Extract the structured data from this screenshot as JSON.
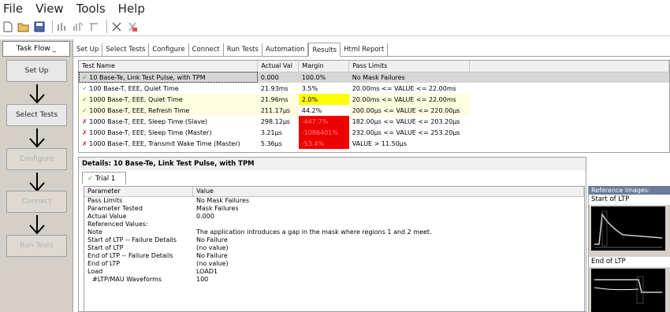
{
  "menu": {
    "items": [
      "File",
      "View",
      "Tools",
      "Help"
    ]
  },
  "toolbar": {
    "buttons": [
      "new-icon",
      "open-icon",
      "save-icon",
      "run-icon",
      "pause-icon",
      "step-icon",
      "stop-icon",
      "clear-icon"
    ]
  },
  "sidebar": {
    "header": "Task Flow",
    "steps": [
      {
        "label": "Set Up",
        "enabled": true
      },
      {
        "label": "Select Tests",
        "enabled": true
      },
      {
        "label": "Configure",
        "enabled": false
      },
      {
        "label": "Connect",
        "enabled": false
      },
      {
        "label": "Run Tests",
        "enabled": false
      }
    ]
  },
  "tabs": [
    "Set Up",
    "Select Tests",
    "Configure",
    "Connect",
    "Run Tests",
    "Automation",
    "Results",
    "Html Report"
  ],
  "active_tab": "Results",
  "results": {
    "columns": [
      "Test Name",
      "Actual Val",
      "Margin",
      "Pass Limits"
    ],
    "rows": [
      {
        "status": "pass",
        "name": "10 Base-Te, Link Test Pulse, with TPM",
        "actual": "0.000",
        "margin": "100.0%",
        "limits": "No Mask Failures",
        "highlight": ""
      },
      {
        "status": "pass",
        "name": "100 Base-T, EEE, Quiet Time",
        "actual": "21.93ms",
        "margin": "3.5%",
        "limits": "20.00ms <= VALUE <= 22.00ms",
        "highlight": ""
      },
      {
        "status": "pass",
        "name": "1000 Base-T, EEE, Quiet Time",
        "actual": "21.96ms",
        "margin": "2.0%",
        "limits": "20.00ms <= VALUE <= 22.00ms",
        "highlight": "yellow"
      },
      {
        "status": "pass",
        "name": "1000 Base-T, EEE, Refresh Time",
        "actual": "211.17µs",
        "margin": "44.2%",
        "limits": "200.00µs <= VALUE <= 220.00µs",
        "highlight": ""
      },
      {
        "status": "fail",
        "name": "1000 Base-T, EEE, Sleep Time (Slave)",
        "actual": "298.12µs",
        "margin": "-447.7%",
        "limits": "182.00µs <= VALUE <= 203.20µs",
        "highlight": "red"
      },
      {
        "status": "fail",
        "name": "1000 Base-T, EEE, Sleep Time (Master)",
        "actual": "3.21µs",
        "margin": "-1086401%",
        "limits": "232.00µs <= VALUE <= 253.20µs",
        "highlight": "red"
      },
      {
        "status": "fail",
        "name": "1000 Base-T, EEE, Transmit Wake Time (Master)",
        "actual": "5.36µs",
        "margin": "-53.4%",
        "limits": "VALUE > 11.50µs",
        "highlight": "red"
      }
    ]
  },
  "details": {
    "title": "Details: 10 Base-Te, Link Test Pulse, with TPM",
    "trial_tab": "Trial 1",
    "columns": [
      "Parameter",
      "Value"
    ],
    "rows": [
      {
        "param": "Pass Limits",
        "value": "No Mask Failures"
      },
      {
        "param": "Parameter Tested",
        "value": "Mask Failures"
      },
      {
        "param": "Actual Value",
        "value": "0.000"
      },
      {
        "param": "Referenced Values:",
        "value": ""
      },
      {
        "param": "Note",
        "value": "The application introduces a gap in the mask where regions 1 and 2 meet."
      },
      {
        "param": "Start of LTP -- Failure Details",
        "value": "No Failure"
      },
      {
        "param": "Start of LTP",
        "value": "(no value)"
      },
      {
        "param": "End of LTP -- Failure Details",
        "value": "No Failure"
      },
      {
        "param": "End of LTP",
        "value": "(no value)"
      },
      {
        "param": "Load",
        "value": "LOAD1"
      },
      {
        "param": "#LTP/MAU Waveforms",
        "value": "100"
      }
    ]
  },
  "reference": {
    "header": "Reference Images:",
    "images": [
      "Start of LTP",
      "End of LTP"
    ]
  }
}
